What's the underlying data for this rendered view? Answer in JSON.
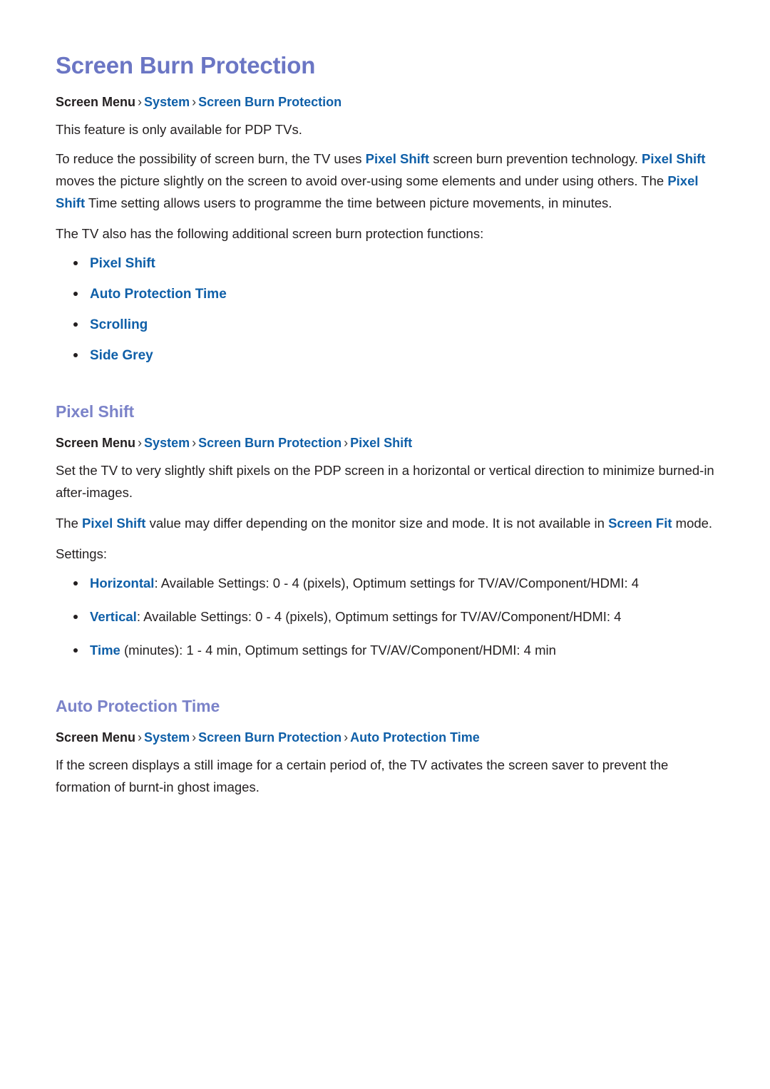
{
  "document": {
    "title": "Screen Burn Protection",
    "accent_title_color": "#6b76c4",
    "link_color": "#0f5fa8",
    "text_color": "#231f20",
    "background_color": "#ffffff"
  },
  "breadcrumbs": {
    "root_label": "Screen Menu",
    "separator": "›",
    "main": {
      "root": "Screen Menu",
      "item1": "System",
      "item2": "Screen Burn Protection"
    },
    "pixel_shift": {
      "root": "Screen Menu",
      "item1": "System",
      "item2": "Screen Burn Protection",
      "item3": "Pixel Shift"
    },
    "auto_protection": {
      "root": "Screen Menu",
      "item1": "System",
      "item2": "Screen Burn Protection",
      "item3": "Auto Protection Time"
    }
  },
  "intro": {
    "availability_note": "This feature is only available for PDP TVs.",
    "paragraph1": {
      "part1": "To reduce the possibility of screen burn, the TV uses ",
      "link1": "Pixel Shift",
      "part2": " screen burn prevention technology. ",
      "link2": "Pixel Shift",
      "part3": " moves the picture slightly on the screen to avoid over-using some elements and under using others. The ",
      "link3": "Pixel Shift",
      "part4": " Time setting allows users to programme the time between picture movements, in minutes."
    },
    "functions_lead": "The TV also has the following additional screen burn protection functions:",
    "function_items": [
      "Pixel Shift",
      "Auto Protection Time",
      "Scrolling",
      "Side Grey"
    ]
  },
  "pixel_shift_section": {
    "heading": "Pixel Shift",
    "paragraph1": "Set the TV to very slightly shift pixels on the PDP screen in a horizontal or vertical direction to minimize burned-in after-images.",
    "paragraph2": {
      "part1": "The ",
      "link1": "Pixel Shift",
      "part2": " value may differ depending on the monitor size and mode. It is not available in ",
      "link2": "Screen Fit",
      "part3": " mode."
    },
    "settings_label": "Settings:",
    "settings": [
      {
        "key": "Horizontal",
        "value": ": Available Settings: 0 - 4 (pixels), Optimum settings for TV/AV/Component/HDMI: 4"
      },
      {
        "key": "Vertical",
        "value": ": Available Settings: 0 - 4 (pixels), Optimum settings for TV/AV/Component/HDMI: 4"
      },
      {
        "key": "Time",
        "value": " (minutes): 1 - 4 min, Optimum settings for TV/AV/Component/HDMI: 4 min"
      }
    ]
  },
  "auto_protection_section": {
    "heading": "Auto Protection Time",
    "paragraph1": "If the screen displays a still image for a certain period of, the TV activates the screen saver to prevent the formation of burnt-in ghost images."
  }
}
